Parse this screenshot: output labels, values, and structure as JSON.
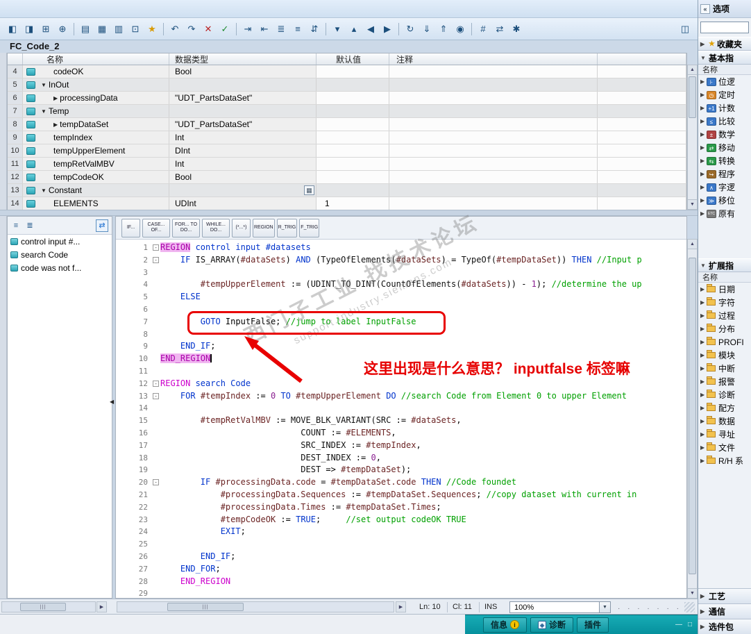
{
  "title_block": "FC_Code_2",
  "toolbar": {
    "items": [
      {
        "name": "split-editor-horizontal-icon",
        "glyph": "◧"
      },
      {
        "name": "split-editor-vertical-icon",
        "glyph": "◨"
      },
      {
        "name": "insert-row-icon",
        "glyph": "⊞"
      },
      {
        "name": "add-row-icon",
        "glyph": "⊕"
      },
      {
        "sep": true
      },
      {
        "name": "keep-actual-values-icon",
        "glyph": "▤"
      },
      {
        "name": "snapshot-icon",
        "glyph": "▦"
      },
      {
        "name": "copy-snapshot-icon",
        "glyph": "▥"
      },
      {
        "name": "reset-start-values-icon",
        "glyph": "⊡"
      },
      {
        "name": "favorites-icon",
        "glyph": "★",
        "color": "#d99a00"
      },
      {
        "sep": true
      },
      {
        "name": "undo-icon",
        "glyph": "↶"
      },
      {
        "name": "redo-icon",
        "glyph": "↷"
      },
      {
        "name": "cancel-edit-icon",
        "glyph": "✕",
        "color": "#bb2222"
      },
      {
        "name": "accept-edit-icon",
        "glyph": "✓",
        "color": "#1d8a2d"
      },
      {
        "sep": true
      },
      {
        "name": "indent-icon",
        "glyph": "⇥"
      },
      {
        "name": "outdent-icon",
        "glyph": "⇤"
      },
      {
        "name": "format-code-icon",
        "glyph": "≣"
      },
      {
        "name": "toggle-comment-icon",
        "glyph": "≡"
      },
      {
        "name": "absolute-symbolic-toggle-icon",
        "glyph": "⇵"
      },
      {
        "sep": true
      },
      {
        "name": "expand-all-regions-icon",
        "glyph": "▾"
      },
      {
        "name": "collapse-all-regions-icon",
        "glyph": "▴"
      },
      {
        "name": "previous-position-icon",
        "glyph": "◀"
      },
      {
        "name": "next-position-icon",
        "glyph": "▶"
      },
      {
        "sep": true
      },
      {
        "name": "compile-icon",
        "glyph": "↻"
      },
      {
        "name": "download-icon",
        "glyph": "⇓"
      },
      {
        "name": "upload-icon",
        "glyph": "⇑"
      },
      {
        "name": "monitor-icon",
        "glyph": "◉"
      },
      {
        "sep": true
      },
      {
        "name": "network-view-icon",
        "glyph": "#"
      },
      {
        "name": "compare-icon",
        "glyph": "⇄"
      },
      {
        "name": "settings-icon",
        "glyph": "✱"
      }
    ],
    "right_item": {
      "name": "editor-layout-icon",
      "glyph": "◫"
    }
  },
  "var_table": {
    "columns": [
      "名称",
      "数据类型",
      "默认值",
      "注释"
    ],
    "rows": [
      {
        "num": "4",
        "kind": "var",
        "name": "codeOK",
        "type": "Bool",
        "default": "",
        "comment": ""
      },
      {
        "num": "5",
        "kind": "group",
        "name": "InOut",
        "type": "",
        "default": "",
        "comment": ""
      },
      {
        "num": "6",
        "kind": "struct",
        "name": "processingData",
        "type": "\"UDT_PartsDataSet\"",
        "default": "",
        "comment": ""
      },
      {
        "num": "7",
        "kind": "group",
        "name": "Temp",
        "type": "",
        "default": "",
        "comment": ""
      },
      {
        "num": "8",
        "kind": "struct",
        "name": "tempDataSet",
        "type": "\"UDT_PartsDataSet\"",
        "default": "",
        "comment": ""
      },
      {
        "num": "9",
        "kind": "var",
        "name": "tempIndex",
        "type": "Int",
        "default": "",
        "comment": ""
      },
      {
        "num": "10",
        "kind": "var",
        "name": "tempUpperElement",
        "type": "DInt",
        "default": "",
        "comment": ""
      },
      {
        "num": "11",
        "kind": "var",
        "name": "tempRetValMBV",
        "type": "Int",
        "default": "",
        "comment": ""
      },
      {
        "num": "12",
        "kind": "var",
        "name": "tempCodeOK",
        "type": "Bool",
        "default": "",
        "comment": ""
      },
      {
        "num": "13",
        "kind": "group",
        "name": "Constant",
        "type": "",
        "default": "",
        "comment": "",
        "button": true
      },
      {
        "num": "14",
        "kind": "var",
        "name": "ELEMENTS",
        "type": "UDInt",
        "default": "1",
        "comment": ""
      }
    ]
  },
  "outline": {
    "toolbar": [
      {
        "name": "expand-outline-icon",
        "glyph": "≡"
      },
      {
        "name": "collapse-outline-icon",
        "glyph": "≣"
      },
      {
        "name": "sync-with-editor-icon",
        "glyph": "⇄",
        "boxed": true
      }
    ],
    "items": [
      {
        "label": "control input #..."
      },
      {
        "label": "search Code"
      },
      {
        "label": "code was not f..."
      }
    ]
  },
  "snippet_tabs": [
    "IF...",
    "CASE... OF...",
    "FOR... TO DO...",
    "WHILE... DO...",
    "(*...*)",
    "REGION",
    "R_TRIG",
    "F_TRIG"
  ],
  "code": {
    "lines": [
      {
        "n": 1,
        "fold": true,
        "s": [
          [
            "rgh",
            "REGION"
          ],
          [
            "rn",
            " control input #datasets"
          ]
        ]
      },
      {
        "n": 2,
        "fold": true,
        "s": [
          [
            "t",
            "    "
          ],
          [
            "k",
            "IF"
          ],
          [
            "t",
            " "
          ],
          [
            "f",
            "IS_ARRAY("
          ],
          [
            "v",
            "#dataSets"
          ],
          [
            "t",
            ") "
          ],
          [
            "k",
            "AND"
          ],
          [
            "t",
            " ("
          ],
          [
            "f",
            "TypeOfElements("
          ],
          [
            "v",
            "#dataSets"
          ],
          [
            "t",
            ") = "
          ],
          [
            "f",
            "TypeOf("
          ],
          [
            "v",
            "#tempDataSet"
          ],
          [
            "t",
            ")) "
          ],
          [
            "k",
            "THEN"
          ],
          [
            "t",
            " "
          ],
          [
            "c",
            "//Input p"
          ]
        ]
      },
      {
        "n": 3,
        "s": []
      },
      {
        "n": 4,
        "s": [
          [
            "t",
            "        "
          ],
          [
            "v",
            "#tempUpperElement"
          ],
          [
            "t",
            " := ("
          ],
          [
            "f",
            "UDINT_TO_DINT("
          ],
          [
            "f",
            "CountOfElements("
          ],
          [
            "v",
            "#dataSets"
          ],
          [
            "t",
            ")) - "
          ],
          [
            "d",
            "1"
          ],
          [
            "t",
            "); "
          ],
          [
            "c",
            "//determine the up"
          ]
        ]
      },
      {
        "n": 5,
        "s": [
          [
            "t",
            "    "
          ],
          [
            "k",
            "ELSE"
          ]
        ]
      },
      {
        "n": 6,
        "s": []
      },
      {
        "n": 7,
        "s": [
          [
            "t",
            "        "
          ],
          [
            "k",
            "GOTO"
          ],
          [
            "t",
            " InputFalse; "
          ],
          [
            "c",
            "//jump to label InputFalse"
          ]
        ]
      },
      {
        "n": 8,
        "s": []
      },
      {
        "n": 9,
        "s": [
          [
            "t",
            "    "
          ],
          [
            "k",
            "END_IF"
          ],
          [
            "t",
            ";"
          ]
        ]
      },
      {
        "n": 10,
        "caret": true,
        "s": [
          [
            "rgh",
            "END_REGION"
          ]
        ]
      },
      {
        "n": 11,
        "s": []
      },
      {
        "n": 12,
        "fold": true,
        "s": [
          [
            "rg",
            "REGION"
          ],
          [
            "rn",
            " search Code"
          ]
        ]
      },
      {
        "n": 13,
        "fold": true,
        "s": [
          [
            "t",
            "    "
          ],
          [
            "k",
            "FOR"
          ],
          [
            "t",
            " "
          ],
          [
            "v",
            "#tempIndex"
          ],
          [
            "t",
            " := "
          ],
          [
            "d",
            "0"
          ],
          [
            "t",
            " "
          ],
          [
            "k",
            "TO"
          ],
          [
            "t",
            " "
          ],
          [
            "v",
            "#tempUpperElement"
          ],
          [
            "t",
            " "
          ],
          [
            "k",
            "DO"
          ],
          [
            "t",
            " "
          ],
          [
            "c",
            "//search Code from Element 0 to upper Element"
          ]
        ]
      },
      {
        "n": 14,
        "s": []
      },
      {
        "n": 15,
        "s": [
          [
            "t",
            "        "
          ],
          [
            "v",
            "#tempRetValMBV"
          ],
          [
            "t",
            " := "
          ],
          [
            "f",
            "MOVE_BLK_VARIANT("
          ],
          [
            "f",
            "SRC"
          ],
          [
            "t",
            " := "
          ],
          [
            "v",
            "#dataSets"
          ],
          [
            "t",
            ","
          ]
        ]
      },
      {
        "n": 16,
        "s": [
          [
            "t",
            "                            "
          ],
          [
            "f",
            "COUNT"
          ],
          [
            "t",
            " := "
          ],
          [
            "v",
            "#ELEMENTS"
          ],
          [
            "t",
            ","
          ]
        ]
      },
      {
        "n": 17,
        "s": [
          [
            "t",
            "                            "
          ],
          [
            "f",
            "SRC_INDEX"
          ],
          [
            "t",
            " := "
          ],
          [
            "v",
            "#tempIndex"
          ],
          [
            "t",
            ","
          ]
        ]
      },
      {
        "n": 18,
        "s": [
          [
            "t",
            "                            "
          ],
          [
            "f",
            "DEST_INDEX"
          ],
          [
            "t",
            " := "
          ],
          [
            "d",
            "0"
          ],
          [
            "t",
            ","
          ]
        ]
      },
      {
        "n": 19,
        "s": [
          [
            "t",
            "                            "
          ],
          [
            "f",
            "DEST"
          ],
          [
            "t",
            " => "
          ],
          [
            "v",
            "#tempDataSet"
          ],
          [
            "t",
            ");"
          ]
        ]
      },
      {
        "n": 20,
        "fold": true,
        "s": [
          [
            "t",
            "        "
          ],
          [
            "k",
            "IF"
          ],
          [
            "t",
            " "
          ],
          [
            "v",
            "#processingData.code"
          ],
          [
            "t",
            " = "
          ],
          [
            "v",
            "#tempDataSet.code"
          ],
          [
            "t",
            " "
          ],
          [
            "k",
            "THEN"
          ],
          [
            "t",
            " "
          ],
          [
            "c",
            "//Code foundet"
          ]
        ]
      },
      {
        "n": 21,
        "s": [
          [
            "t",
            "            "
          ],
          [
            "v",
            "#processingData.Sequences"
          ],
          [
            "t",
            " := "
          ],
          [
            "v",
            "#tempDataSet.Sequences"
          ],
          [
            "t",
            "; "
          ],
          [
            "c",
            "//copy dataset with current in"
          ]
        ]
      },
      {
        "n": 22,
        "s": [
          [
            "t",
            "            "
          ],
          [
            "v",
            "#processingData.Times"
          ],
          [
            "t",
            " := "
          ],
          [
            "v",
            "#tempDataSet.Times"
          ],
          [
            "t",
            ";"
          ]
        ]
      },
      {
        "n": 23,
        "s": [
          [
            "t",
            "            "
          ],
          [
            "v",
            "#tempCodeOK"
          ],
          [
            "t",
            " := "
          ],
          [
            "k",
            "TRUE"
          ],
          [
            "t",
            ";     "
          ],
          [
            "c",
            "//set output codeOK TRUE"
          ]
        ]
      },
      {
        "n": 24,
        "s": [
          [
            "t",
            "            "
          ],
          [
            "k",
            "EXIT"
          ],
          [
            "t",
            ";"
          ]
        ]
      },
      {
        "n": 25,
        "s": []
      },
      {
        "n": 26,
        "s": [
          [
            "t",
            "        "
          ],
          [
            "k",
            "END_IF"
          ],
          [
            "t",
            ";"
          ]
        ]
      },
      {
        "n": 27,
        "s": [
          [
            "t",
            "    "
          ],
          [
            "k",
            "END_FOR"
          ],
          [
            "t",
            ";"
          ]
        ]
      },
      {
        "n": 28,
        "s": [
          [
            "t",
            "    "
          ],
          [
            "rg",
            "END_REGION"
          ]
        ]
      },
      {
        "n": 29,
        "s": []
      }
    ]
  },
  "annotation": {
    "note": "这里出现是什么意思？  inputfalse 标签嘛"
  },
  "watermark": {
    "line1": "西门子工业 找技术论坛",
    "line2": "support.industry.siemens.com"
  },
  "status": {
    "ln": "Ln: 10",
    "cl": "Cl: 11",
    "mode": "INS",
    "zoom": "100%"
  },
  "bottom_bar": {
    "tabs": [
      {
        "label": "信息",
        "badge": "i"
      },
      {
        "label": "诊断",
        "icon": "diagnostics-icon",
        "icon_glyph": "◈"
      },
      {
        "label": "插件"
      }
    ],
    "window_icons": [
      {
        "name": "minimize-inspector-icon",
        "glyph": "—"
      },
      {
        "name": "float-inspector-icon",
        "glyph": "□"
      }
    ]
  },
  "options_panel": {
    "title": "选项",
    "favorites_label": "收藏夹",
    "sections": [
      {
        "label": "基本指",
        "name_header": "名称",
        "items": [
          {
            "label": "位逻",
            "icon": "bit-logic-icon",
            "glyph": "⊦",
            "color": "#3a78c9"
          },
          {
            "label": "定时",
            "icon": "timer-operations-icon",
            "glyph": "◷",
            "color": "#d9872a"
          },
          {
            "label": "计数",
            "icon": "counter-operations-icon",
            "glyph": "+1",
            "color": "#3a78c9"
          },
          {
            "label": "比较",
            "icon": "comparator-operations-icon",
            "glyph": "≤",
            "color": "#3a78c9"
          },
          {
            "label": "数学",
            "icon": "math-functions-icon",
            "glyph": "±",
            "color": "#b04343"
          },
          {
            "label": "移动",
            "icon": "move-operations-icon",
            "glyph": "⇄",
            "color": "#2a9a4a"
          },
          {
            "label": "转换",
            "icon": "conversion-operations-icon",
            "glyph": "⇆",
            "color": "#2a9a4a"
          },
          {
            "label": "程序",
            "icon": "program-control-icon",
            "glyph": "↪",
            "color": "#9a6a2a"
          },
          {
            "label": "字逻",
            "icon": "word-logic-icon",
            "glyph": "∧",
            "color": "#3a78c9"
          },
          {
            "label": "移位",
            "icon": "shift-rotate-icon",
            "glyph": "≫",
            "color": "#3a78c9"
          },
          {
            "label": "原有",
            "icon": "legacy-icon",
            "glyph": "ETC",
            "color": "#7a7a7a"
          }
        ]
      },
      {
        "label": "扩展指",
        "name_header": "名称",
        "items": [
          {
            "label": "日期"
          },
          {
            "label": "字符"
          },
          {
            "label": "过程"
          },
          {
            "label": "分布"
          },
          {
            "label": "PROFI"
          },
          {
            "label": "模块"
          },
          {
            "label": "中断"
          },
          {
            "label": "报警"
          },
          {
            "label": "诊断"
          },
          {
            "label": "配方"
          },
          {
            "label": "数据"
          },
          {
            "label": "寻址"
          },
          {
            "label": "文件"
          },
          {
            "label": "R/H 系"
          }
        ]
      }
    ],
    "bottom_sections": [
      {
        "label": "工艺"
      },
      {
        "label": "通信"
      },
      {
        "label": "选件包"
      }
    ]
  }
}
